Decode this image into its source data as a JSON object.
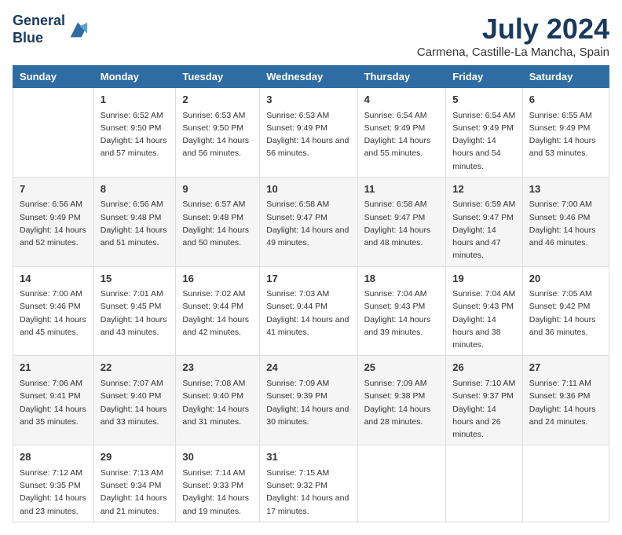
{
  "logo": {
    "line1": "General",
    "line2": "Blue"
  },
  "title": "July 2024",
  "subtitle": "Carmena, Castille-La Mancha, Spain",
  "header_days": [
    "Sunday",
    "Monday",
    "Tuesday",
    "Wednesday",
    "Thursday",
    "Friday",
    "Saturday"
  ],
  "weeks": [
    [
      {
        "day": "",
        "content": ""
      },
      {
        "day": "1",
        "content": "Sunrise: 6:52 AM\nSunset: 9:50 PM\nDaylight: 14 hours\nand 57 minutes."
      },
      {
        "day": "2",
        "content": "Sunrise: 6:53 AM\nSunset: 9:50 PM\nDaylight: 14 hours\nand 56 minutes."
      },
      {
        "day": "3",
        "content": "Sunrise: 6:53 AM\nSunset: 9:49 PM\nDaylight: 14 hours\nand 56 minutes."
      },
      {
        "day": "4",
        "content": "Sunrise: 6:54 AM\nSunset: 9:49 PM\nDaylight: 14 hours\nand 55 minutes."
      },
      {
        "day": "5",
        "content": "Sunrise: 6:54 AM\nSunset: 9:49 PM\nDaylight: 14 hours\nand 54 minutes."
      },
      {
        "day": "6",
        "content": "Sunrise: 6:55 AM\nSunset: 9:49 PM\nDaylight: 14 hours\nand 53 minutes."
      }
    ],
    [
      {
        "day": "7",
        "content": "Sunrise: 6:56 AM\nSunset: 9:49 PM\nDaylight: 14 hours\nand 52 minutes."
      },
      {
        "day": "8",
        "content": "Sunrise: 6:56 AM\nSunset: 9:48 PM\nDaylight: 14 hours\nand 51 minutes."
      },
      {
        "day": "9",
        "content": "Sunrise: 6:57 AM\nSunset: 9:48 PM\nDaylight: 14 hours\nand 50 minutes."
      },
      {
        "day": "10",
        "content": "Sunrise: 6:58 AM\nSunset: 9:47 PM\nDaylight: 14 hours\nand 49 minutes."
      },
      {
        "day": "11",
        "content": "Sunrise: 6:58 AM\nSunset: 9:47 PM\nDaylight: 14 hours\nand 48 minutes."
      },
      {
        "day": "12",
        "content": "Sunrise: 6:59 AM\nSunset: 9:47 PM\nDaylight: 14 hours\nand 47 minutes."
      },
      {
        "day": "13",
        "content": "Sunrise: 7:00 AM\nSunset: 9:46 PM\nDaylight: 14 hours\nand 46 minutes."
      }
    ],
    [
      {
        "day": "14",
        "content": "Sunrise: 7:00 AM\nSunset: 9:46 PM\nDaylight: 14 hours\nand 45 minutes."
      },
      {
        "day": "15",
        "content": "Sunrise: 7:01 AM\nSunset: 9:45 PM\nDaylight: 14 hours\nand 43 minutes."
      },
      {
        "day": "16",
        "content": "Sunrise: 7:02 AM\nSunset: 9:44 PM\nDaylight: 14 hours\nand 42 minutes."
      },
      {
        "day": "17",
        "content": "Sunrise: 7:03 AM\nSunset: 9:44 PM\nDaylight: 14 hours\nand 41 minutes."
      },
      {
        "day": "18",
        "content": "Sunrise: 7:04 AM\nSunset: 9:43 PM\nDaylight: 14 hours\nand 39 minutes."
      },
      {
        "day": "19",
        "content": "Sunrise: 7:04 AM\nSunset: 9:43 PM\nDaylight: 14 hours\nand 38 minutes."
      },
      {
        "day": "20",
        "content": "Sunrise: 7:05 AM\nSunset: 9:42 PM\nDaylight: 14 hours\nand 36 minutes."
      }
    ],
    [
      {
        "day": "21",
        "content": "Sunrise: 7:06 AM\nSunset: 9:41 PM\nDaylight: 14 hours\nand 35 minutes."
      },
      {
        "day": "22",
        "content": "Sunrise: 7:07 AM\nSunset: 9:40 PM\nDaylight: 14 hours\nand 33 minutes."
      },
      {
        "day": "23",
        "content": "Sunrise: 7:08 AM\nSunset: 9:40 PM\nDaylight: 14 hours\nand 31 minutes."
      },
      {
        "day": "24",
        "content": "Sunrise: 7:09 AM\nSunset: 9:39 PM\nDaylight: 14 hours\nand 30 minutes."
      },
      {
        "day": "25",
        "content": "Sunrise: 7:09 AM\nSunset: 9:38 PM\nDaylight: 14 hours\nand 28 minutes."
      },
      {
        "day": "26",
        "content": "Sunrise: 7:10 AM\nSunset: 9:37 PM\nDaylight: 14 hours\nand 26 minutes."
      },
      {
        "day": "27",
        "content": "Sunrise: 7:11 AM\nSunset: 9:36 PM\nDaylight: 14 hours\nand 24 minutes."
      }
    ],
    [
      {
        "day": "28",
        "content": "Sunrise: 7:12 AM\nSunset: 9:35 PM\nDaylight: 14 hours\nand 23 minutes."
      },
      {
        "day": "29",
        "content": "Sunrise: 7:13 AM\nSunset: 9:34 PM\nDaylight: 14 hours\nand 21 minutes."
      },
      {
        "day": "30",
        "content": "Sunrise: 7:14 AM\nSunset: 9:33 PM\nDaylight: 14 hours\nand 19 minutes."
      },
      {
        "day": "31",
        "content": "Sunrise: 7:15 AM\nSunset: 9:32 PM\nDaylight: 14 hours\nand 17 minutes."
      },
      {
        "day": "",
        "content": ""
      },
      {
        "day": "",
        "content": ""
      },
      {
        "day": "",
        "content": ""
      }
    ]
  ]
}
